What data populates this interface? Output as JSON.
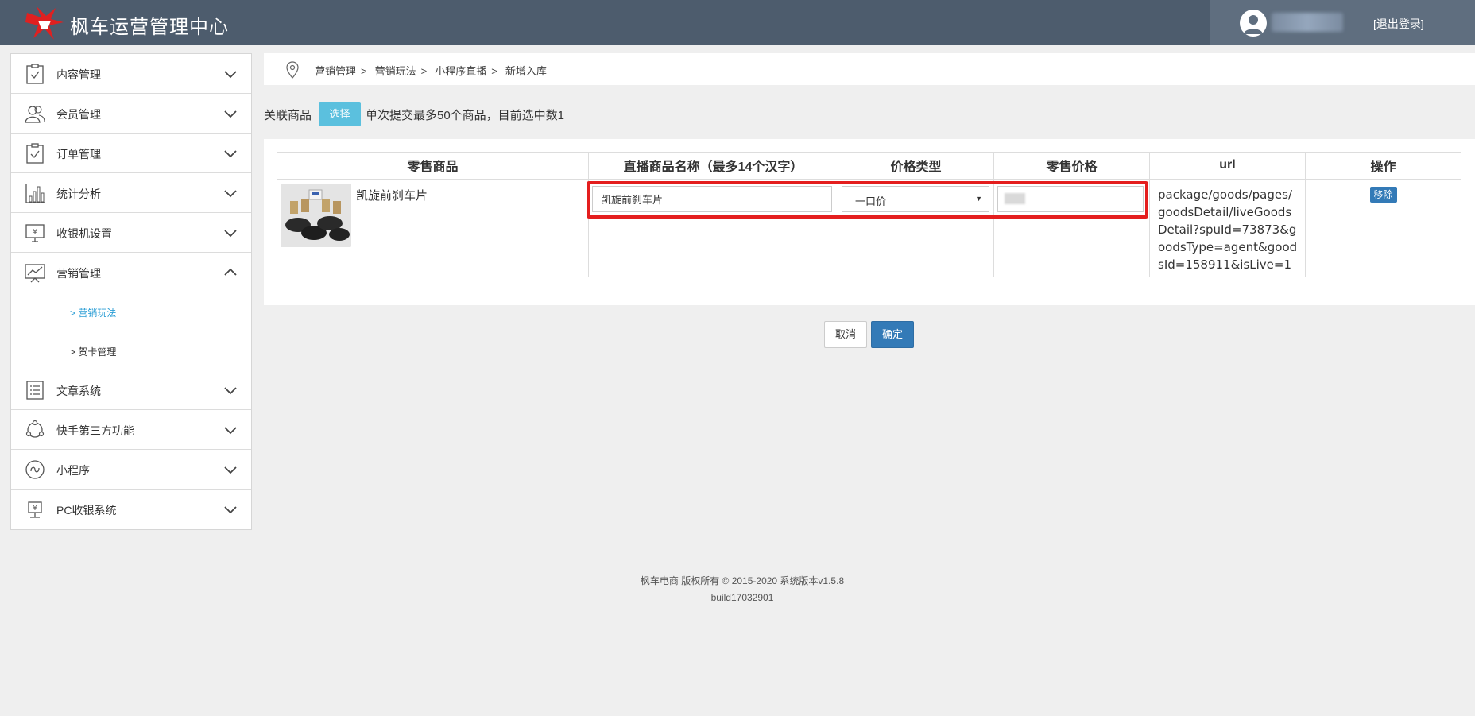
{
  "header": {
    "title": "枫车运营管理中心",
    "logout": "[退出登录]"
  },
  "sidebar": {
    "items": [
      {
        "label": "内容管理",
        "icon": "clipboard-icon"
      },
      {
        "label": "会员管理",
        "icon": "users-icon"
      },
      {
        "label": "订单管理",
        "icon": "clipboard-icon"
      },
      {
        "label": "统计分析",
        "icon": "bar-chart-icon"
      },
      {
        "label": "收银机设置",
        "icon": "cashier-monitor-icon"
      },
      {
        "label": "营销管理",
        "icon": "presentation-chart-icon",
        "expanded": true
      },
      {
        "label": "文章系统",
        "icon": "list-icon"
      },
      {
        "label": "快手第三方功能",
        "icon": "cycle-icon"
      },
      {
        "label": "小程序",
        "icon": "mini-program-icon"
      },
      {
        "label": "PC收银系统",
        "icon": "pc-cashier-icon"
      }
    ],
    "subitems": [
      {
        "label": "> 营销玩法",
        "active": true
      },
      {
        "label": "> 贺卡管理",
        "active": false
      }
    ]
  },
  "breadcrumb": [
    "营销管理",
    ">",
    "营销玩法",
    ">",
    "小程序直播",
    ">",
    "新增入库"
  ],
  "toolbar": {
    "label": "关联商品",
    "select_button": "选择",
    "hint": "单次提交最多50个商品，目前选中数1"
  },
  "table": {
    "columns": [
      "零售商品",
      "直播商品名称（最多14个汉字）",
      "价格类型",
      "零售价格",
      "url",
      "操作"
    ],
    "rows": [
      {
        "product_name": "凯旋前刹车片",
        "live_name": "凯旋前刹车片",
        "price_type": "一口价",
        "url": "package/goods/pages/goodsDetail/liveGoodsDetail?spuId=73873&goodsType=agent&goodsId=158911&isLive=1",
        "action": "移除"
      }
    ]
  },
  "actions": {
    "cancel": "取消",
    "confirm": "确定"
  },
  "footer": {
    "copyright": "枫车电商 版权所有 © 2015-2020 系统版本v1.5.8",
    "build": "build17032901"
  },
  "colors": {
    "header_bg": "#4d5c6d",
    "accent_blue": "#337ab7",
    "info_blue": "#5bc0de",
    "highlight_red": "#e41e1e",
    "active_link": "#2e9fd6"
  }
}
